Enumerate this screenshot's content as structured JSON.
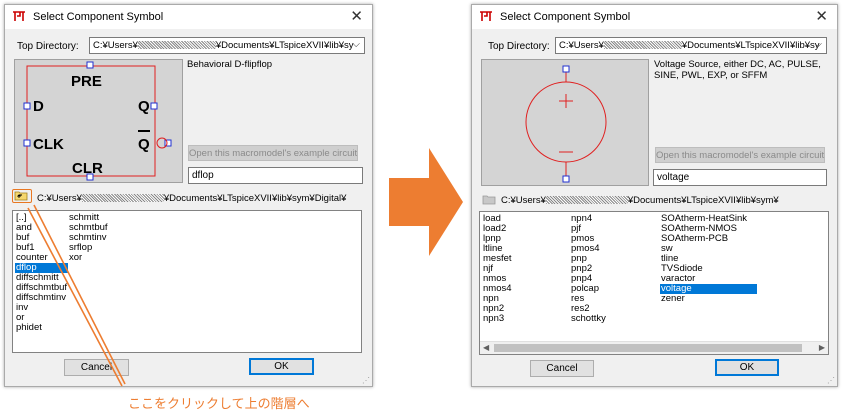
{
  "left": {
    "title": "Select Component Symbol",
    "top_dir_label": "Top Directory:",
    "top_dir_prefix": "C:¥Users¥",
    "top_dir_suffix": "¥Documents¥LTspiceXVII¥lib¥sy",
    "symbol_pins": {
      "pre": "PRE",
      "d": "D",
      "q": "Q",
      "clk": "CLK",
      "qbar": "Q",
      "clr": "CLR"
    },
    "description": "Behavioral D-flipflop",
    "example_button": "Open this macromodel's example circuit",
    "name_value": "dflop",
    "path_prefix": "C:¥Users¥",
    "path_suffix": "¥Documents¥LTspiceXVII¥lib¥sym¥Digital¥",
    "list_col1": [
      "[..]",
      "and",
      "buf",
      "buf1",
      "counter",
      "dflop",
      "diffschmitt",
      "diffschmtbuf",
      "diffschmtinv",
      "inv",
      "or",
      "phidet"
    ],
    "list_col2": [
      "schmitt",
      "schmtbuf",
      "schmtinv",
      "srflop",
      "xor"
    ],
    "selected": "dflop",
    "cancel": "Cancel",
    "ok": "OK"
  },
  "right": {
    "title": "Select Component Symbol",
    "top_dir_label": "Top Directory:",
    "top_dir_prefix": "C:¥Users¥",
    "top_dir_suffix": "¥Documents¥LTspiceXVII¥lib¥sy",
    "description": "Voltage Source, either DC, AC, PULSE, SINE, PWL, EXP, or SFFM",
    "example_button": "Open this macromodel's example circuit",
    "name_value": "voltage",
    "path_prefix": "C:¥Users¥",
    "path_suffix": "¥Documents¥LTspiceXVII¥lib¥sym¥",
    "list_col1": [
      "load",
      "load2",
      "lpnp",
      "ltline",
      "mesfet",
      "njf",
      "nmos",
      "nmos4",
      "npn",
      "npn2",
      "npn3"
    ],
    "list_col2": [
      "npn4",
      "pjf",
      "pmos",
      "pmos4",
      "pnp",
      "pnp2",
      "pnp4",
      "polcap",
      "res",
      "res2",
      "schottky"
    ],
    "list_col3": [
      "SOAtherm-HeatSink",
      "SOAtherm-NMOS",
      "SOAtherm-PCB",
      "sw",
      "tline",
      "TVSdiode",
      "varactor",
      "voltage",
      "zener"
    ],
    "selected": "voltage",
    "cancel": "Cancel",
    "ok": "OK"
  },
  "annotation": "ここをクリックして上の階層へ",
  "colors": {
    "accent": "#e87722",
    "selection": "#0078d7",
    "symbol_red": "#e02020"
  }
}
